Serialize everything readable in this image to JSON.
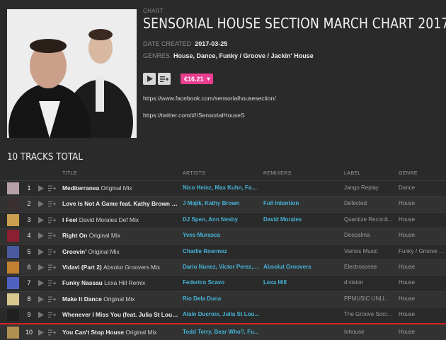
{
  "release": {
    "kicker": "CHART",
    "title": "SENSORIAL HOUSE SECTION MARCH CHART 2017",
    "date_label": "DATE CREATED",
    "date": "2017-03-25",
    "genres_label": "GENRES",
    "genres": "House, Dance, Funky / Groove / Jackin' House",
    "price": "€16.21",
    "links": [
      "https://www.facebook.com/sensorialhousesection/",
      "https://twitter.com/#!/SensorialHouseS"
    ],
    "total": "10 TRACKS TOTAL"
  },
  "table": {
    "headers": {
      "title": "TITLE",
      "artists": "ARTISTS",
      "remixers": "REMIXERS",
      "label": "LABEL",
      "genre": "GENRE"
    },
    "rows": [
      {
        "num": "1",
        "title": "Mediterranea",
        "mix": "Original Mix",
        "artists": "Nico Heinz, Max Kuhn, Fab...",
        "remixers": "",
        "label": "Jango Replay",
        "genre": "Dance",
        "thumb": "#b8a0a8"
      },
      {
        "num": "2",
        "title": "Love Is Not A Game feat. Kathy Brown",
        "mix": "F...",
        "artists": "J Majik, Kathy Brown",
        "remixers": "Full Intention",
        "label": "Defected",
        "genre": "House",
        "thumb": "#3a3030"
      },
      {
        "num": "3",
        "title": "I Feel",
        "mix": "David Morales Def Mix",
        "artists": "DJ Spen, Ann Nesby",
        "remixers": "David Morales",
        "label": "Quantize Recordi...",
        "genre": "House",
        "thumb": "#caa050"
      },
      {
        "num": "4",
        "title": "Right On",
        "mix": "Original Mix",
        "artists": "Yves Murasca",
        "remixers": "",
        "label": "Deepalma",
        "genre": "House",
        "thumb": "#8a2030"
      },
      {
        "num": "5",
        "title": "Groovin'",
        "mix": "Original Mix",
        "artists": "Charlie Roennez",
        "remixers": "",
        "label": "Vamos Music",
        "genre": "Funky / Groove /...",
        "thumb": "#4a5aa0"
      },
      {
        "num": "6",
        "title": "Vidavi (Part 2)",
        "mix": "Absolut Groovers Mix",
        "artists": "Dario Nunez, Victor Perez, ...",
        "remixers": "Absolut Groovers",
        "label": "Electroscene",
        "genre": "House",
        "thumb": "#c08030"
      },
      {
        "num": "7",
        "title": "Funky Nassau",
        "mix": "Lexa Hill Remix",
        "artists": "Federico Scavo",
        "remixers": "Lexa Hill",
        "label": "d:vision",
        "genre": "House",
        "thumb": "#5060c0"
      },
      {
        "num": "8",
        "title": "Make It Dance",
        "mix": "Original Mix",
        "artists": "Rio Dela Duna",
        "remixers": "",
        "label": "PPMUSIC UNLIMI...",
        "genre": "House",
        "thumb": "#d8c890"
      },
      {
        "num": "9",
        "title": "Whenever I Miss You (feat. Julia St Loui...",
        "mix": "",
        "artists": "Alain Ducroix, Julia St Lou...",
        "remixers": "",
        "label": "The Groove Society",
        "genre": "House",
        "thumb": "#202020"
      },
      {
        "num": "10",
        "title": "You Can't Stop House",
        "mix": "Original Mix",
        "artists": "Todd Terry, Bear Who?, Fu...",
        "remixers": "",
        "label": "Inhouse",
        "genre": "House",
        "thumb": "#b09050"
      }
    ]
  }
}
